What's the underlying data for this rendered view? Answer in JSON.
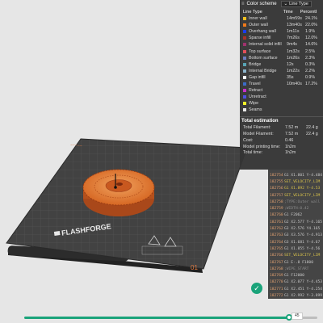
{
  "color_scheme": {
    "title": "Color scheme",
    "selected": "Line Type",
    "columns": [
      "Line Type",
      "Time",
      "Percent",
      "Ⅰ"
    ],
    "rows": [
      {
        "name": "Inner wall",
        "time": "14m59s",
        "pct": "24.1%",
        "color": "#f0c020"
      },
      {
        "name": "Outer wall",
        "time": "13m40s",
        "pct": "22.0%",
        "color": "#f07a1a"
      },
      {
        "name": "Overhang wall",
        "time": "1m11s",
        "pct": "1.9%",
        "color": "#1a3cf0"
      },
      {
        "name": "Sparse infill",
        "time": "7m26s",
        "pct": "12.0%",
        "color": "#a8322a"
      },
      {
        "name": "Internal solid infill",
        "time": "9m4s",
        "pct": "14.6%",
        "color": "#a0326e"
      },
      {
        "name": "Top surface",
        "time": "1m32s",
        "pct": "2.5%",
        "color": "#e2505a"
      },
      {
        "name": "Bottom surface",
        "time": "1m26s",
        "pct": "2.3%",
        "color": "#6c7cc0"
      },
      {
        "name": "Bridge",
        "time": "12s",
        "pct": "0.3%",
        "color": "#58a4b4"
      },
      {
        "name": "Internal Bridge",
        "time": "1m22s",
        "pct": "2.2%",
        "color": "#8cb4cc"
      },
      {
        "name": "Gap infill",
        "time": "35s",
        "pct": "0.9%",
        "color": "#ffffff"
      },
      {
        "name": "Travel",
        "time": "10m40s",
        "pct": "17.2%",
        "color": "#3c6cc8"
      },
      {
        "name": "Retract",
        "time": "",
        "pct": "",
        "color": "#c830c8"
      },
      {
        "name": "Unretract",
        "time": "",
        "pct": "",
        "color": "#5050e0"
      },
      {
        "name": "Wipe",
        "time": "",
        "pct": "",
        "color": "#f0f028"
      },
      {
        "name": "Seams",
        "time": "",
        "pct": "",
        "color": "#e8e8e8"
      }
    ],
    "total_title": "Total estimation",
    "estimates": [
      {
        "label": "Total Filament:",
        "v1": "7.52 m",
        "v2": "22.4 g"
      },
      {
        "label": "Model Filament:",
        "v1": "7.52 m",
        "v2": "22.4 g"
      },
      {
        "label": "Cost:",
        "v1": "0.46",
        "v2": ""
      },
      {
        "label": "Model printing time:",
        "v1": "1h2m",
        "v2": ""
      },
      {
        "label": "Total time:",
        "v1": "1h2m",
        "v2": ""
      }
    ]
  },
  "gcode": [
    {
      "ln": "182754",
      "cmd": "G1 X1.801 Y-4.484",
      "style": ""
    },
    {
      "ln": "182755",
      "cmd": "SET_VELOCITY_LIM",
      "style": "hl"
    },
    {
      "ln": "182756",
      "cmd": "G1 X1.892 Y-4.53",
      "style": "hl"
    },
    {
      "ln": "182757",
      "cmd": "SET_VELOCITY_LIM",
      "style": "hl"
    },
    {
      "ln": "182758",
      "cmd": ";TYPE:Outer wall",
      "style": "dim"
    },
    {
      "ln": "182759",
      "cmd": ";WIDTH:0.42",
      "style": "dim"
    },
    {
      "ln": "182760",
      "cmd": "G1 F2062",
      "style": ""
    },
    {
      "ln": "182761",
      "cmd": "G2 X2.577 Y-4.165",
      "style": ""
    },
    {
      "ln": "182762",
      "cmd": "G3 X2.576 Y4.165",
      "style": ""
    },
    {
      "ln": "182763",
      "cmd": "G3 X3.576 Y-4.913",
      "style": ""
    },
    {
      "ln": "182764",
      "cmd": "G3 X1.681 Y-4.67",
      "style": ""
    },
    {
      "ln": "182765",
      "cmd": "G1 X1.855 Y-4.56",
      "style": ""
    },
    {
      "ln": "182766",
      "cmd": "SET_VELOCITY_LIM",
      "style": "hl"
    },
    {
      "ln": "182767",
      "cmd": "G1 E-.8 F1800",
      "style": ""
    },
    {
      "ln": "182768",
      "cmd": ";WIPE_START",
      "style": "dim"
    },
    {
      "ln": "182769",
      "cmd": "G1 F12000",
      "style": ""
    },
    {
      "ln": "182770",
      "cmd": "G1 X2.077 Y-4.453",
      "style": ""
    },
    {
      "ln": "182771",
      "cmd": "G1 X2.451 Y-4.254",
      "style": ""
    },
    {
      "ln": "182772",
      "cmd": "G1 X2.992 Y-3.899",
      "style": ""
    },
    {
      "ln": "182773",
      "cmd": "G1 X3.475 Y-3.478",
      "style": ""
    }
  ],
  "bed": {
    "brand": "FLASHFORGE",
    "plate_number": "01"
  },
  "slider": {
    "value": "45",
    "fraction": 0.9
  }
}
